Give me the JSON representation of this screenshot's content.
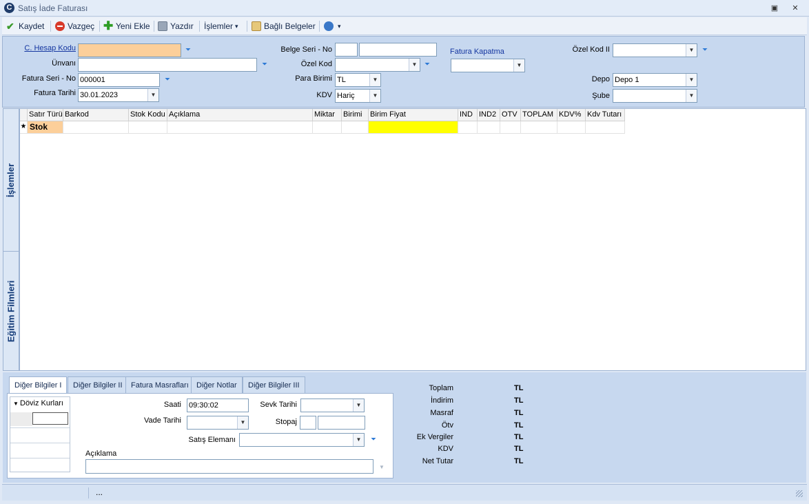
{
  "window": {
    "title": "Satış İade Faturası",
    "restore_glyph": "▣",
    "close_glyph": "✕"
  },
  "toolbar": {
    "save": "Kaydet",
    "cancel": "Vazgeç",
    "add_new": "Yeni Ekle",
    "print": "Yazdır",
    "actions": "İşlemler",
    "linked_docs": "Bağlı Belgeler",
    "dropdown_glyph": "▾"
  },
  "header": {
    "account_code_label": "C. Hesap Kodu",
    "account_code_value": "",
    "title_label": "Ünvanı",
    "title_value": "",
    "invoice_series_label": "Fatura Seri - No",
    "invoice_no_value": "000001",
    "invoice_date_label": "Fatura Tarihi",
    "invoice_date_value": "30.01.2023",
    "doc_series_label": "Belge Seri - No",
    "doc_series_value": "",
    "doc_no_value": "",
    "special_code_label": "Özel Kod",
    "special_code_value": "",
    "currency_label": "Para Birimi",
    "currency_value": "TL",
    "vat_label": "KDV",
    "vat_value": "Hariç",
    "invoice_close_label": "Fatura Kapatma",
    "invoice_close_value": "",
    "special_code2_label": "Özel Kod II",
    "special_code2_value": "",
    "warehouse_label": "Depo",
    "warehouse_value": "Depo 1",
    "branch_label": "Şube",
    "branch_value": ""
  },
  "side_tabs": [
    "İşlemler",
    "Eğitim Filmleri"
  ],
  "grid": {
    "columns": [
      "Satır Türü",
      "Barkod",
      "Stok Kodu",
      "Açıklama",
      "Miktar",
      "Birimi",
      "Birim Fiyat",
      "IND",
      "IND2",
      "OTV",
      "TOPLAM",
      "KDV%",
      "Kdv Tutarı"
    ],
    "new_row_marker": "★",
    "row_type": "Stok",
    "colors": {
      "row_type_bg": "#fccf9a",
      "price_bg": "#ffff00"
    }
  },
  "bottom_tabs": [
    "Diğer Bilgiler I",
    "Diğer Bilgiler II",
    "Fatura Masrafları",
    "Diğer Notlar",
    "Diğer Bilgiler III"
  ],
  "other_info": {
    "currency_rates_label": "Döviz Kurları",
    "time_label": "Saati",
    "time_value": "09:30:02",
    "ship_date_label": "Sevk Tarihi",
    "ship_date_value": "",
    "due_date_label": "Vade Tarihi",
    "due_date_value": "",
    "withholding_label": "Stopaj",
    "sales_rep_label": "Satış Elemanı",
    "sales_rep_value": "",
    "description_label": "Açıklama",
    "description_value": ""
  },
  "summary": [
    {
      "label": "Toplam",
      "value": "TL"
    },
    {
      "label": "İndirim",
      "value": "TL"
    },
    {
      "label": "Masraf",
      "value": "TL"
    },
    {
      "label": "Ötv",
      "value": "TL"
    },
    {
      "label": "Ek Vergiler",
      "value": "TL"
    },
    {
      "label": "KDV",
      "value": "TL"
    },
    {
      "label": "Net Tutar",
      "value": "TL"
    }
  ],
  "status": {
    "text": "..."
  },
  "icons": {
    "save": "check-icon",
    "cancel": "no-entry-icon",
    "add": "plus-icon",
    "print": "printer-icon",
    "linked": "documents-icon",
    "help": "help-icon",
    "filter": "funnel-icon"
  }
}
